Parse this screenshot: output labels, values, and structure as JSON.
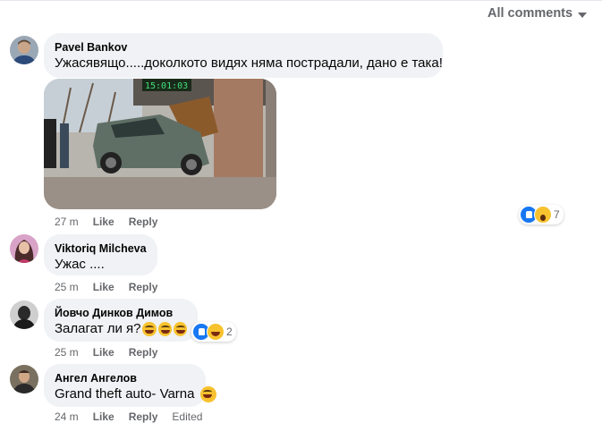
{
  "header": {
    "all_comments_label": "All comments"
  },
  "comments": [
    {
      "author": "Pavel Bankov",
      "text": "Ужасявящо.....доколкото видях няма пострадали, дано е така!",
      "time": "27 m",
      "like": "Like",
      "reply": "Reply",
      "reaction_count": "7",
      "reactions": [
        "like-icon",
        "wow-icon"
      ]
    },
    {
      "author": "Viktoriq Milcheva",
      "text": "Ужас ....",
      "time": "25 m",
      "like": "Like",
      "reply": "Reply"
    },
    {
      "author": "Йовчо Динков Димов",
      "text": "Залагат ли я?",
      "time": "25 m",
      "like": "Like",
      "reply": "Reply",
      "reaction_count": "2",
      "reactions": [
        "like-icon",
        "haha-icon"
      ]
    },
    {
      "author": "Ангел Ангелов",
      "text": "Grand theft auto- Varna",
      "time": "24 m",
      "like": "Like",
      "reply": "Reply",
      "edited": "Edited"
    }
  ],
  "photo": {
    "clock_text": "15:01:03"
  },
  "colors": {
    "bubble": "#f0f2f5",
    "meta": "#65676b",
    "like_blue": "#1877f2",
    "emoji_yellow": "#f7c22e"
  }
}
